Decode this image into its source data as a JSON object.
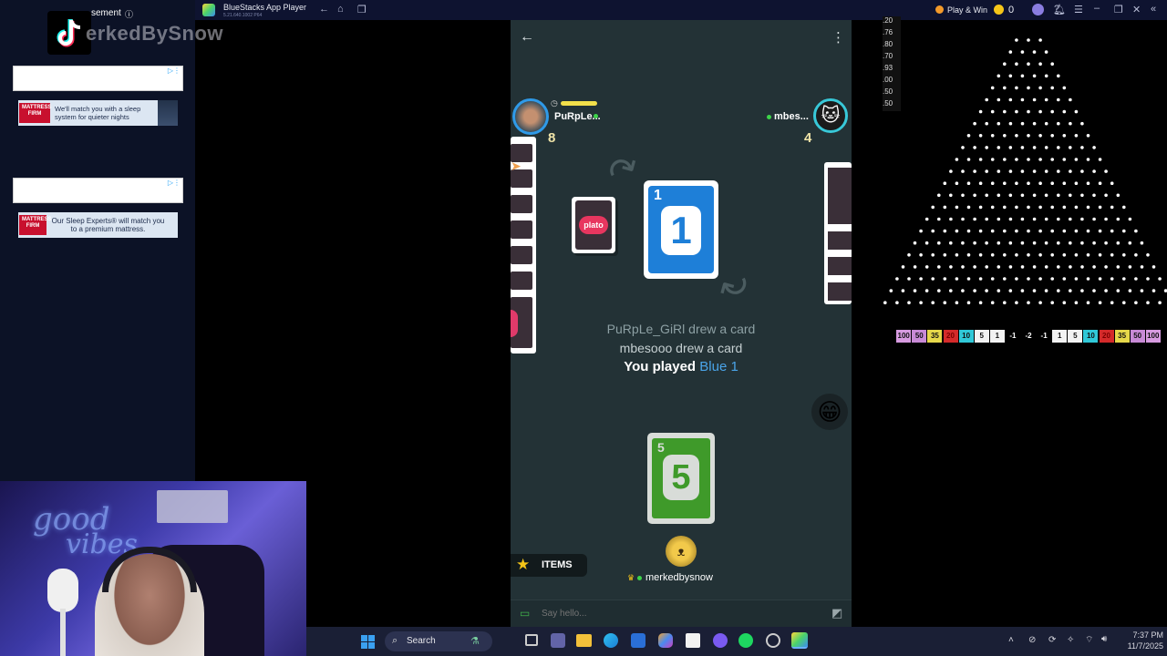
{
  "left_panel": {
    "ad_label": "sement",
    "watermark": "erkedBySnow",
    "ad1": {
      "text": "We'll match you with a sleep system for quieter nights",
      "logo": "MATTRESS FIRM"
    },
    "ad2": {
      "text": "Our Sleep Experts® will match you to a premium mattress.",
      "logo": "MATTRESS FIRM"
    }
  },
  "webcam": {
    "neon_line1": "good",
    "neon_line2": "vibes"
  },
  "bluestacks": {
    "title": "BlueStacks App Player",
    "subtitle": "5.21.640.1002 P64",
    "play_win": "Play & Win",
    "coins": "0"
  },
  "game": {
    "opponent_left": {
      "name": "PuRpLe...",
      "count": "8"
    },
    "opponent_right": {
      "name": "mbes...",
      "count": "4"
    },
    "deck_label": "plato",
    "top_card": {
      "value": "1",
      "color": "#1e7fd8"
    },
    "log": [
      "PuRpLe_GiRl drew a card",
      "mbesooo drew a card"
    ],
    "log_played_prefix": "You played",
    "log_played_card": "Blue 1",
    "hand_card": {
      "value": "5",
      "color": "#3f9a2a"
    },
    "items_label": "ITEMS",
    "self_name": "merkedbysnow",
    "emoji": "😁",
    "chat_placeholder": "Say hello..."
  },
  "plinko": {
    "multipliers": [
      ".20",
      ".76",
      ".80",
      ".70",
      ".93",
      ".00",
      ".50",
      ".50"
    ],
    "slots": [
      {
        "v": "100",
        "c": "#d79be0"
      },
      {
        "v": "50",
        "c": "#c88ad6"
      },
      {
        "v": "35",
        "c": "#e6d84a"
      },
      {
        "v": "20",
        "c": "#d42a2a"
      },
      {
        "v": "10",
        "c": "#30c8d8"
      },
      {
        "v": "5",
        "c": "#f2f2f2"
      },
      {
        "v": "1",
        "c": "#f2f2f2"
      },
      {
        "v": "-1",
        "c": "#000000"
      },
      {
        "v": "-2",
        "c": "#000000"
      },
      {
        "v": "-1",
        "c": "#000000"
      },
      {
        "v": "1",
        "c": "#f2f2f2"
      },
      {
        "v": "5",
        "c": "#f2f2f2"
      },
      {
        "v": "10",
        "c": "#30c8d8"
      },
      {
        "v": "20",
        "c": "#d42a2a"
      },
      {
        "v": "35",
        "c": "#e6d84a"
      },
      {
        "v": "50",
        "c": "#c88ad6"
      },
      {
        "v": "100",
        "c": "#d79be0"
      }
    ]
  },
  "taskbar": {
    "search_label": "Search",
    "time": "7:37 PM",
    "date": "11/7/2025"
  }
}
